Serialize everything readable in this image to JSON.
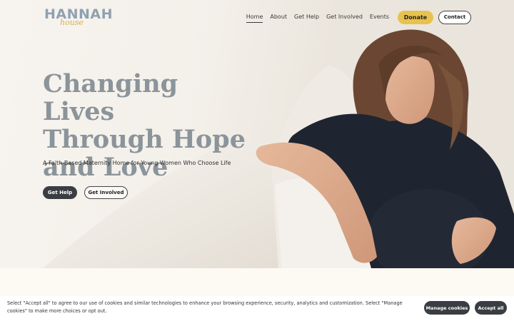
{
  "brand": {
    "logo_main": "HANNAH",
    "logo_script": "house",
    "logo_label": "Hannah House logo"
  },
  "nav": {
    "links": [
      "Home",
      "About",
      "Get Help",
      "Get Involved",
      "Events"
    ],
    "active": "Home",
    "donate": "Donate",
    "contact": "Contact"
  },
  "hero": {
    "headline_lines": [
      "Changing Lives",
      "Through Hope",
      "and Love"
    ],
    "subheadline": "A Faith-Based Maternity Home for Young Women Who Choose Life",
    "cta_primary": "Get Help",
    "cta_secondary": "Get Involved",
    "image_description": "Pregnant woman smiling, sitting by white pillows"
  },
  "cookie_banner": {
    "text": "Select \"Accept all\" to agree to our use of cookies and similar technologies to enhance your browsing experience, security, analytics and customization. Select \"Manage cookies\" to make more choices or opt out.",
    "manage_label": "Manage cookies",
    "accept_label": "Accept all"
  },
  "colors": {
    "accent_yellow": "#e8c24f",
    "headline_gray": "#8b949a",
    "logo_blue": "#8fa1b1",
    "dark_button": "#3a3d42",
    "cream_section": "#fdf9f3"
  }
}
